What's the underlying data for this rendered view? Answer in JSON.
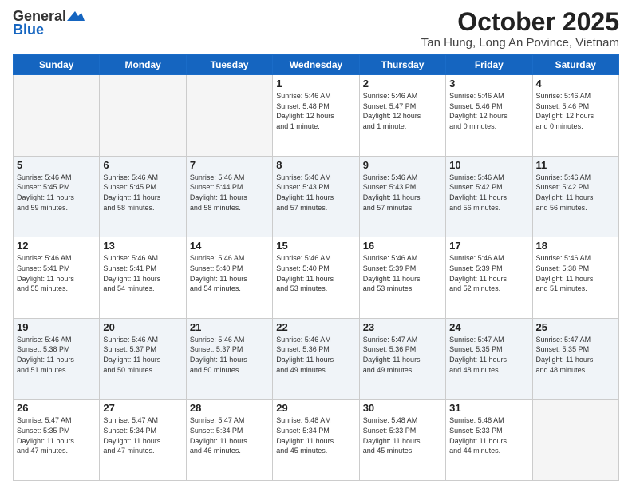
{
  "header": {
    "logo_general": "General",
    "logo_blue": "Blue",
    "month": "October 2025",
    "location": "Tan Hung, Long An Povince, Vietnam"
  },
  "days_of_week": [
    "Sunday",
    "Monday",
    "Tuesday",
    "Wednesday",
    "Thursday",
    "Friday",
    "Saturday"
  ],
  "weeks": [
    [
      {
        "day": "",
        "info": ""
      },
      {
        "day": "",
        "info": ""
      },
      {
        "day": "",
        "info": ""
      },
      {
        "day": "1",
        "info": "Sunrise: 5:46 AM\nSunset: 5:48 PM\nDaylight: 12 hours\nand 1 minute."
      },
      {
        "day": "2",
        "info": "Sunrise: 5:46 AM\nSunset: 5:47 PM\nDaylight: 12 hours\nand 1 minute."
      },
      {
        "day": "3",
        "info": "Sunrise: 5:46 AM\nSunset: 5:46 PM\nDaylight: 12 hours\nand 0 minutes."
      },
      {
        "day": "4",
        "info": "Sunrise: 5:46 AM\nSunset: 5:46 PM\nDaylight: 12 hours\nand 0 minutes."
      }
    ],
    [
      {
        "day": "5",
        "info": "Sunrise: 5:46 AM\nSunset: 5:45 PM\nDaylight: 11 hours\nand 59 minutes."
      },
      {
        "day": "6",
        "info": "Sunrise: 5:46 AM\nSunset: 5:45 PM\nDaylight: 11 hours\nand 58 minutes."
      },
      {
        "day": "7",
        "info": "Sunrise: 5:46 AM\nSunset: 5:44 PM\nDaylight: 11 hours\nand 58 minutes."
      },
      {
        "day": "8",
        "info": "Sunrise: 5:46 AM\nSunset: 5:43 PM\nDaylight: 11 hours\nand 57 minutes."
      },
      {
        "day": "9",
        "info": "Sunrise: 5:46 AM\nSunset: 5:43 PM\nDaylight: 11 hours\nand 57 minutes."
      },
      {
        "day": "10",
        "info": "Sunrise: 5:46 AM\nSunset: 5:42 PM\nDaylight: 11 hours\nand 56 minutes."
      },
      {
        "day": "11",
        "info": "Sunrise: 5:46 AM\nSunset: 5:42 PM\nDaylight: 11 hours\nand 56 minutes."
      }
    ],
    [
      {
        "day": "12",
        "info": "Sunrise: 5:46 AM\nSunset: 5:41 PM\nDaylight: 11 hours\nand 55 minutes."
      },
      {
        "day": "13",
        "info": "Sunrise: 5:46 AM\nSunset: 5:41 PM\nDaylight: 11 hours\nand 54 minutes."
      },
      {
        "day": "14",
        "info": "Sunrise: 5:46 AM\nSunset: 5:40 PM\nDaylight: 11 hours\nand 54 minutes."
      },
      {
        "day": "15",
        "info": "Sunrise: 5:46 AM\nSunset: 5:40 PM\nDaylight: 11 hours\nand 53 minutes."
      },
      {
        "day": "16",
        "info": "Sunrise: 5:46 AM\nSunset: 5:39 PM\nDaylight: 11 hours\nand 53 minutes."
      },
      {
        "day": "17",
        "info": "Sunrise: 5:46 AM\nSunset: 5:39 PM\nDaylight: 11 hours\nand 52 minutes."
      },
      {
        "day": "18",
        "info": "Sunrise: 5:46 AM\nSunset: 5:38 PM\nDaylight: 11 hours\nand 51 minutes."
      }
    ],
    [
      {
        "day": "19",
        "info": "Sunrise: 5:46 AM\nSunset: 5:38 PM\nDaylight: 11 hours\nand 51 minutes."
      },
      {
        "day": "20",
        "info": "Sunrise: 5:46 AM\nSunset: 5:37 PM\nDaylight: 11 hours\nand 50 minutes."
      },
      {
        "day": "21",
        "info": "Sunrise: 5:46 AM\nSunset: 5:37 PM\nDaylight: 11 hours\nand 50 minutes."
      },
      {
        "day": "22",
        "info": "Sunrise: 5:46 AM\nSunset: 5:36 PM\nDaylight: 11 hours\nand 49 minutes."
      },
      {
        "day": "23",
        "info": "Sunrise: 5:47 AM\nSunset: 5:36 PM\nDaylight: 11 hours\nand 49 minutes."
      },
      {
        "day": "24",
        "info": "Sunrise: 5:47 AM\nSunset: 5:35 PM\nDaylight: 11 hours\nand 48 minutes."
      },
      {
        "day": "25",
        "info": "Sunrise: 5:47 AM\nSunset: 5:35 PM\nDaylight: 11 hours\nand 48 minutes."
      }
    ],
    [
      {
        "day": "26",
        "info": "Sunrise: 5:47 AM\nSunset: 5:35 PM\nDaylight: 11 hours\nand 47 minutes."
      },
      {
        "day": "27",
        "info": "Sunrise: 5:47 AM\nSunset: 5:34 PM\nDaylight: 11 hours\nand 47 minutes."
      },
      {
        "day": "28",
        "info": "Sunrise: 5:47 AM\nSunset: 5:34 PM\nDaylight: 11 hours\nand 46 minutes."
      },
      {
        "day": "29",
        "info": "Sunrise: 5:48 AM\nSunset: 5:34 PM\nDaylight: 11 hours\nand 45 minutes."
      },
      {
        "day": "30",
        "info": "Sunrise: 5:48 AM\nSunset: 5:33 PM\nDaylight: 11 hours\nand 45 minutes."
      },
      {
        "day": "31",
        "info": "Sunrise: 5:48 AM\nSunset: 5:33 PM\nDaylight: 11 hours\nand 44 minutes."
      },
      {
        "day": "",
        "info": ""
      }
    ]
  ]
}
